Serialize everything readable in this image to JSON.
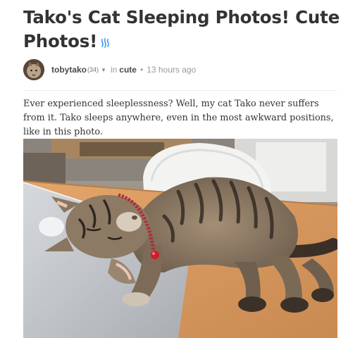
{
  "post": {
    "title": "Tako's Cat Sleeping Photos! Cute Photos!",
    "title_icon": "steem-icon",
    "author": {
      "name": "tobytako",
      "reputation": "(34)",
      "dropdown_icon": "caret-down-icon"
    },
    "in_label": "in",
    "category": "cute",
    "separator": "•",
    "timestamp": "13 hours ago",
    "body": "Ever experienced sleeplessness? Well, my cat Tako never suffers from it. Tako sleeps anywhere, even in the most awkward positions, like in this photo.",
    "image": {
      "subject": "tabby-cat-sleeping-on-laptop"
    }
  },
  "colors": {
    "title": "#333333",
    "meta_text": "#9a9a9a",
    "meta_strong": "#4a4a4a",
    "steem_icon": "#4ba2f2",
    "divider": "#ececec"
  }
}
